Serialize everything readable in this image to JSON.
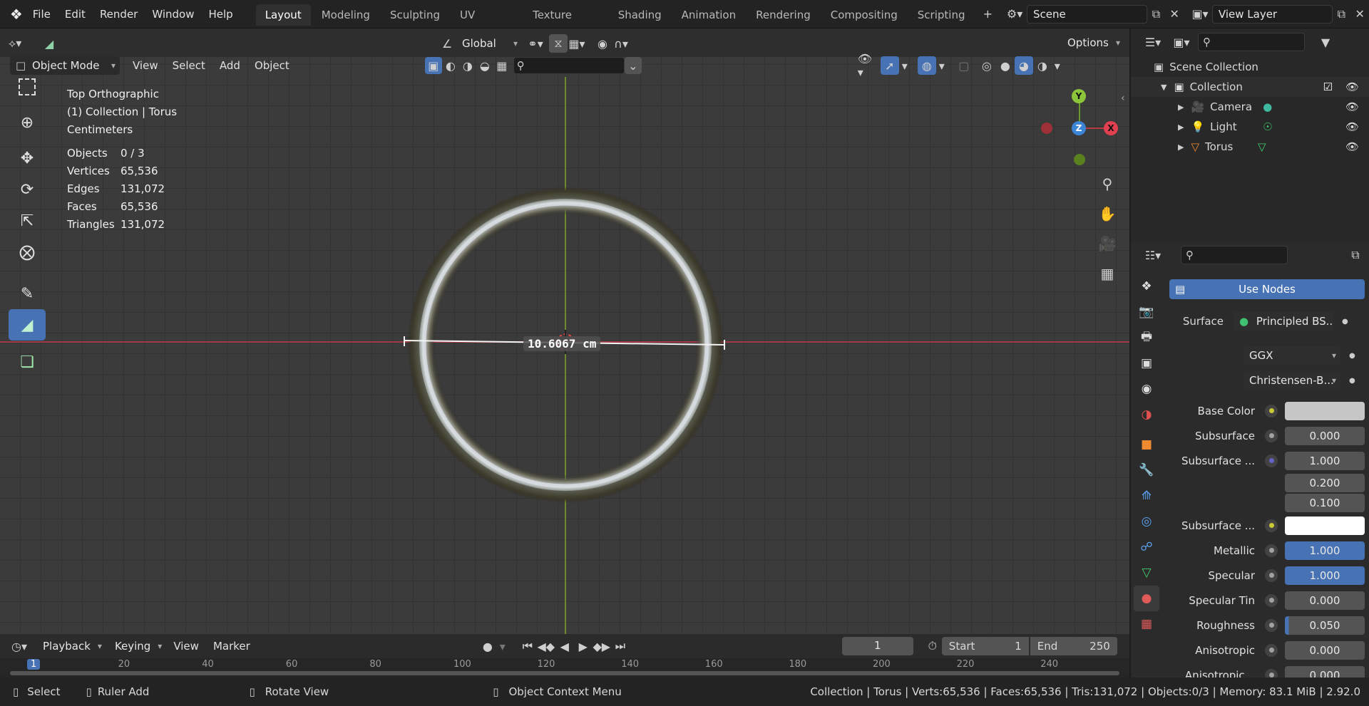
{
  "menu": [
    "File",
    "Edit",
    "Render",
    "Window",
    "Help"
  ],
  "workspaces": [
    {
      "label": "Layout",
      "active": true
    },
    {
      "label": "Modeling"
    },
    {
      "label": "Sculpting"
    },
    {
      "label": "UV Editing"
    },
    {
      "label": "Texture Paint"
    },
    {
      "label": "Shading"
    },
    {
      "label": "Animation"
    },
    {
      "label": "Rendering"
    },
    {
      "label": "Compositing"
    },
    {
      "label": "Scripting"
    }
  ],
  "scene": "Scene",
  "view_layer": "View Layer",
  "header": {
    "transform": "Global",
    "options": "Options",
    "mode": "Object Mode",
    "view": "View",
    "select": "Select",
    "add": "Add",
    "object": "Object"
  },
  "overlay": {
    "view_name": "Top Orthographic",
    "collection": "(1) Collection | Torus",
    "units": "Centimeters",
    "stats": [
      {
        "label": "Objects",
        "value": "0 / 3"
      },
      {
        "label": "Vertices",
        "value": "65,536"
      },
      {
        "label": "Edges",
        "value": "131,072"
      },
      {
        "label": "Faces",
        "value": "65,536"
      },
      {
        "label": "Triangles",
        "value": "131,072"
      }
    ]
  },
  "ruler_label": "10.6067 cm",
  "gizmo": {
    "x": "X",
    "y": "Y",
    "z": "Z"
  },
  "outliner": {
    "scene_collection": "Scene Collection",
    "collection": "Collection",
    "items": [
      {
        "label": "Camera"
      },
      {
        "label": "Light"
      },
      {
        "label": "Torus"
      }
    ]
  },
  "properties": {
    "use_nodes": "Use Nodes",
    "surface_label": "Surface",
    "surface_value": "Principled BS...",
    "distribution": "GGX",
    "subsurface_method": "Christensen-B...",
    "rows": [
      {
        "label": "Base Color",
        "dot": "#c9c933",
        "type": "color",
        "color": "#c6c6c6"
      },
      {
        "label": "Subsurface",
        "dot": "#a0a0a0",
        "value": "0.000"
      },
      {
        "label": "Subsurface ...",
        "dot": "#6363c7",
        "value": "1.000"
      },
      {
        "label": "",
        "dot": "",
        "value": "0.200"
      },
      {
        "label": "",
        "dot": "",
        "value": "0.100"
      },
      {
        "label": "Subsurface ...",
        "dot": "#c9c933",
        "type": "color",
        "color": "#ffffff"
      },
      {
        "label": "Metallic",
        "dot": "#a0a0a0",
        "value": "1.000",
        "blue": true
      },
      {
        "label": "Specular",
        "dot": "#a0a0a0",
        "value": "1.000",
        "blue": true
      },
      {
        "label": "Specular Tin",
        "dot": "#a0a0a0",
        "value": "0.000"
      },
      {
        "label": "Roughness",
        "dot": "#a0a0a0",
        "value": "0.050",
        "fill": 0.05
      },
      {
        "label": "Anisotropic",
        "dot": "#a0a0a0",
        "value": "0.000"
      },
      {
        "label": "Anisotropic...",
        "dot": "#a0a0a0",
        "value": "0.000"
      }
    ]
  },
  "timeline": {
    "playback": "Playback",
    "keying": "Keying",
    "view": "View",
    "marker": "Marker",
    "current_frame": "1",
    "start_label": "Start",
    "start": "1",
    "end_label": "End",
    "end": "250",
    "ticks": [
      "1",
      "20",
      "40",
      "60",
      "80",
      "100",
      "120",
      "140",
      "160",
      "180",
      "200",
      "220",
      "240"
    ]
  },
  "status": {
    "select": "Select",
    "ruler_add": "Ruler Add",
    "rotate_view": "Rotate View",
    "context_menu": "Object Context Menu",
    "info": "Collection | Torus | Verts:65,536 | Faces:65,536 | Tris:131,072 | Objects:0/3 | Memory: 83.1 MiB | 2.92.0"
  }
}
